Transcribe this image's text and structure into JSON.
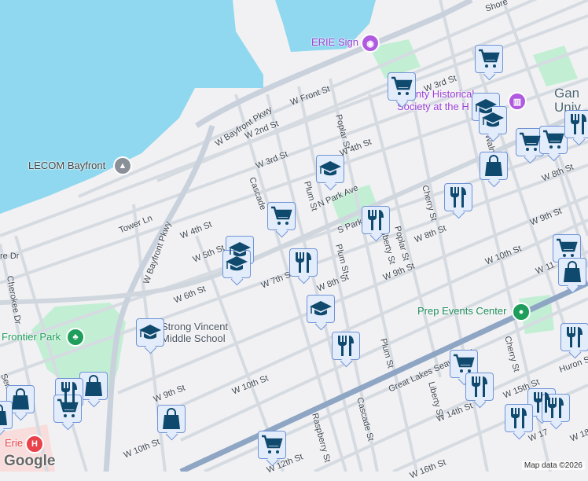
{
  "pois": {
    "erie_sign": "ERIE Sign",
    "lecom": "LECOM Bayfront",
    "historical": "County Historical\nSociety at the H",
    "gannon": "Gan\nUniv",
    "prep": "Prep Events Center",
    "frontier": "Frontier Park",
    "strong_vincent": "Strong Vincent\nMiddle School",
    "erie_hospital": "Erie"
  },
  "streets": {
    "bayfront1": "W Bayfront Pkwy",
    "bayfront2": "W Bayfront Pkwy",
    "front": "W Front St",
    "w2": "W 2nd St",
    "w3a": "W 3rd St",
    "w3b": "W 3rd St",
    "w4a": "W 4th St",
    "w4b": "W 4th St",
    "w5": "W 5th St",
    "w6": "W 6th St",
    "npark": "N Park Ave",
    "spark": "S Park",
    "w7": "W 7th St",
    "w8a": "W 8th St",
    "w8b": "W 8th St",
    "w8c": "W 8th St",
    "w9a": "W 9th St",
    "w9b": "W 9th St",
    "w9c": "W 9th St",
    "w10a": "W 10th St",
    "w10b": "W 10th St",
    "w10c": "W 10th St",
    "w11": "W 11",
    "w12": "W 12th St",
    "w14": "W 14th St",
    "w15": "W 15th St",
    "w16": "W 16th St",
    "w17": "W 17",
    "w18": "W 18",
    "seaway": "Great Lakes Seaway Trl",
    "tower": "Tower Ln",
    "cherokee": "Cherokee Dr",
    "seminole": "Seminole",
    "poplar1": "Poplar St",
    "poplar2": "Poplar St",
    "plum1": "Plum St",
    "plum2": "Plum St",
    "plum3": "Plum St",
    "cascade1": "Cascade",
    "cascade2": "Cascade St",
    "raspberry": "Raspberry St",
    "liberty1": "Liberty St",
    "liberty2": "Liberty St",
    "cherry1": "Cherry St",
    "cherry2": "Cherry St",
    "walnut": "Walnut St",
    "huron": "Huron St",
    "shore": "Shore",
    "re_dr": "re Dr"
  },
  "markers": [
    "grocery",
    "grocery",
    "school",
    "school",
    "grocery",
    "grocery",
    "restaurant",
    "shopping",
    "school",
    "restaurant",
    "grocery",
    "restaurant",
    "school",
    "school",
    "restaurant",
    "grocery",
    "shopping",
    "school",
    "school",
    "restaurant",
    "restaurant",
    "grocery",
    "restaurant",
    "restaurant",
    "restaurant",
    "restaurant",
    "shopping",
    "shopping",
    "restaurant",
    "grocery",
    "shopping",
    "grocery",
    "shopping"
  ],
  "attribution": "Map data ©2026",
  "google_logo": "Google",
  "colors": {
    "water": "#8fd8ef",
    "park": "#bfeed0",
    "marker_bg": "#e3ecfb",
    "marker_icon": "#0f4a6e",
    "poi_purple": "#9a3fd6",
    "poi_green": "#1e9e5a",
    "hospital": "#e8434a"
  }
}
